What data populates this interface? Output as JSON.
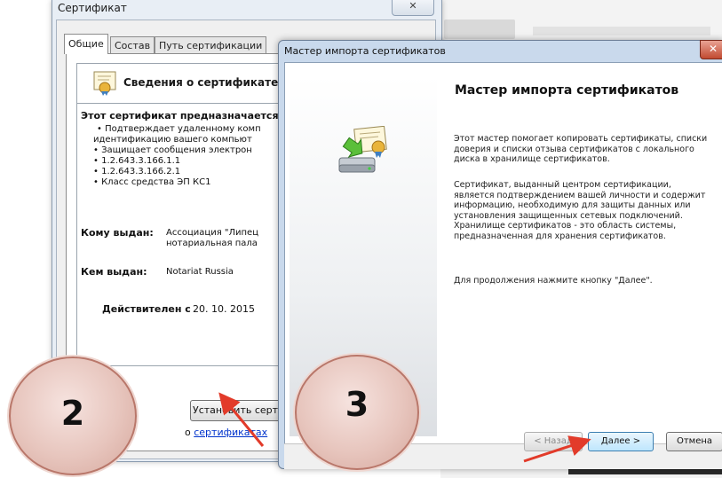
{
  "cert_window": {
    "title": "Сертификат",
    "close_symbol": "✕",
    "tabs": [
      "Общие",
      "Состав",
      "Путь сертификации"
    ],
    "info_header": "Сведения о сертификате",
    "purpose_title": "Этот сертификат предназначается",
    "purpose_lines": [
      "• Подтверждает удаленному комп",
      "идентификацию вашего компьют",
      "• Защищает сообщения электрон",
      "• 1.2.643.3.166.1.1",
      "• 1.2.643.3.166.2.1",
      "• Класс средства ЭП КС1"
    ],
    "issued_to_label": "Кому выдан:",
    "issued_to_value_1": "Ассоциация \"Липец",
    "issued_to_value_2": "нотариальная пала",
    "issued_by_label": "Кем выдан:",
    "issued_by_value": "Notariat Russia",
    "valid_label": "Действителен с",
    "valid_value": "20. 10. 2015",
    "install_button": "Установить сертификат...",
    "more_prefix": "о",
    "more_link": "сертификатах"
  },
  "wizard": {
    "title": "Мастер импорта сертификатов",
    "close_symbol": "✕",
    "heading": "Мастер импорта сертификатов",
    "paragraph_1": "Этот мастер помогает копировать сертификаты, списки доверия и списки отзыва сертификатов с локального диска в хранилище сертификатов.",
    "paragraph_2": "Сертификат, выданный центром сертификации, является подтверждением вашей личности и содержит информацию, необходимую для защиты данных или установления защищенных сетевых подключений. Хранилище сертификатов - это область системы, предназначенная для хранения сертификатов.",
    "paragraph_3": "Для продолжения нажмите кнопку \"Далее\".",
    "back_button": "< Назад",
    "next_button": "Далее >",
    "cancel_button": "Отмена"
  },
  "annotations": {
    "step_2": "2",
    "step_3": "3",
    "circle_color": "#e7c5bd",
    "arrow_color": "#e23b2a"
  }
}
